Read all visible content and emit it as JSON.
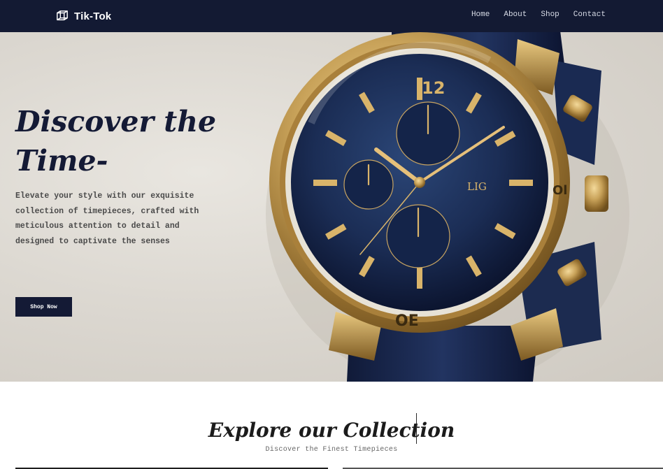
{
  "brand": {
    "name": "Tik-Tok",
    "icon": "cube-icon"
  },
  "nav": {
    "links": [
      "Home",
      "About",
      "Shop",
      "Contact"
    ]
  },
  "hero": {
    "title_line1": "Discover the",
    "title_line2": "Time-",
    "description": "Elevate your style with our exquisite collection of timepieces, crafted with meticulous attention to detail and designed to captivate the senses",
    "button_label": "Shop Now",
    "image": "gold-navy-chronograph-watch",
    "watch_logo": "LIG"
  },
  "collection": {
    "title": "Explore our Collection",
    "subtitle": "Discover the Finest Timepieces"
  },
  "colors": {
    "navbar": "#131a33",
    "accent": "#141a35",
    "gold": "#c9a35a",
    "dial": "#1b2d55"
  }
}
